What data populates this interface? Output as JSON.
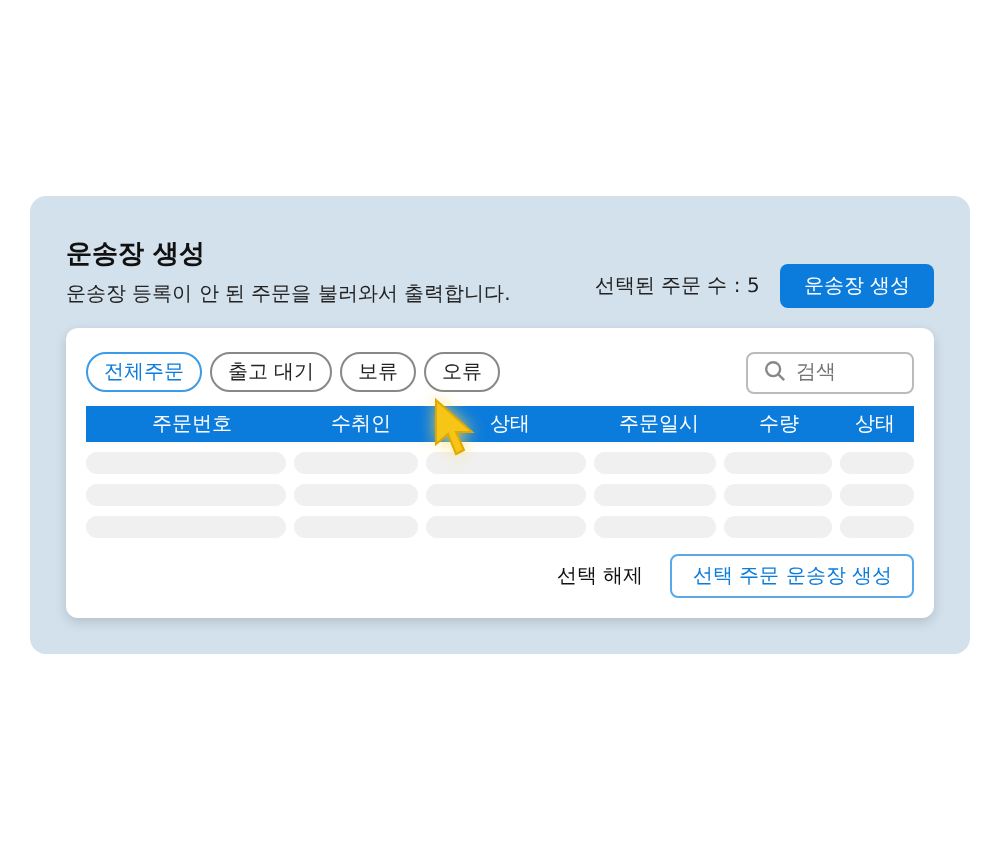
{
  "header": {
    "title": "운송장 생성",
    "subtitle": "운송장 등록이 안 된 주문을 불러와서 출력합니다.",
    "selected_count": "선택된 주문 수 : 5",
    "create_button": "운송장 생성"
  },
  "filters": [
    {
      "label": "전체주문",
      "selected": true
    },
    {
      "label": "출고 대기",
      "selected": false
    },
    {
      "label": "보류",
      "selected": false
    },
    {
      "label": "오류",
      "selected": false
    }
  ],
  "search": {
    "placeholder": "검색"
  },
  "table": {
    "columns": [
      "주문번호",
      "수취인",
      "상태",
      "주문일시",
      "수량",
      "상태"
    ],
    "rows": [
      {
        "kind": "skeleton"
      },
      {
        "kind": "skeleton"
      },
      {
        "kind": "skeleton"
      }
    ]
  },
  "footer": {
    "clear_button": "선택 해제",
    "create_selected_button": "선택 주문 운송장 생성"
  }
}
